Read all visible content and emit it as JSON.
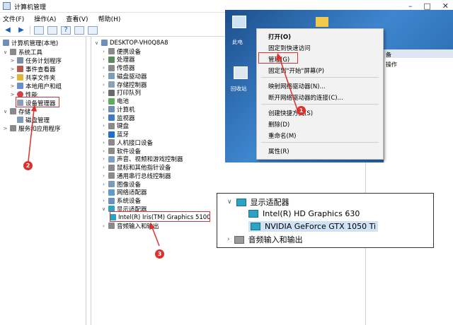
{
  "window": {
    "title": "计算机管理"
  },
  "menu": [
    "文件(F)",
    "操作(A)",
    "查看(V)",
    "帮助(H)"
  ],
  "left_tree": [
    {
      "label": "计算机管理(本地)",
      "level": 0,
      "chev": ""
    },
    {
      "label": "系统工具",
      "level": 1,
      "chev": "∨"
    },
    {
      "label": "任务计划程序",
      "level": 2,
      "chev": ">"
    },
    {
      "label": "事件查看器",
      "level": 2,
      "chev": ">"
    },
    {
      "label": "共享文件夹",
      "level": 2,
      "chev": ">"
    },
    {
      "label": "本地用户和组",
      "level": 2,
      "chev": ">"
    },
    {
      "label": "性能",
      "level": 2,
      "chev": ">"
    },
    {
      "label": "设备管理器",
      "level": 2,
      "chev": ""
    },
    {
      "label": "存储",
      "level": 1,
      "chev": "∨"
    },
    {
      "label": "磁盘管理",
      "level": 2,
      "chev": ""
    },
    {
      "label": "服务和应用程序",
      "level": 1,
      "chev": ">"
    }
  ],
  "device_tree": {
    "root": "DESKTOP-VH0Q8A8",
    "items": [
      "便携设备",
      "处理器",
      "传感器",
      "磁盘驱动器",
      "存储控制器",
      "打印队列",
      "电池",
      "计算机",
      "监视器",
      "键盘",
      "蓝牙",
      "人机接口设备",
      "软件设备",
      "声音、视频和游戏控制器",
      "鼠标和其他指针设备",
      "通用串行总线控制器",
      "图像设备",
      "网络适配器",
      "系统设备",
      "显示适配器"
    ],
    "display_child": "Intel(R) Iris(TM) Graphics 5100",
    "after": "音频输入和输出"
  },
  "context_menu": {
    "items": [
      "打开(O)",
      "固定到快速访问",
      "管理(G)",
      "固定到\"开始\"屏幕(P)",
      "映射网络驱动器(N)...",
      "断开网络驱动器的连接(C)...",
      "创建快捷方式(S)",
      "删除(D)",
      "重命名(M)",
      "属性(R)"
    ],
    "desktop_labels": [
      "此电",
      "回收站"
    ]
  },
  "right_pane": {
    "header": "备",
    "action": "操作"
  },
  "zoom_callout": {
    "parent": "显示适配器",
    "children": [
      "Intel(R) HD Graphics 630",
      "NVIDIA GeForce GTX 1050 Ti"
    ],
    "after": "音频输入和输出"
  },
  "badges": [
    "1",
    "2",
    "3"
  ],
  "colors": {
    "annotation_red": "#e0302b",
    "desktop_blue": "#2f6db3"
  }
}
